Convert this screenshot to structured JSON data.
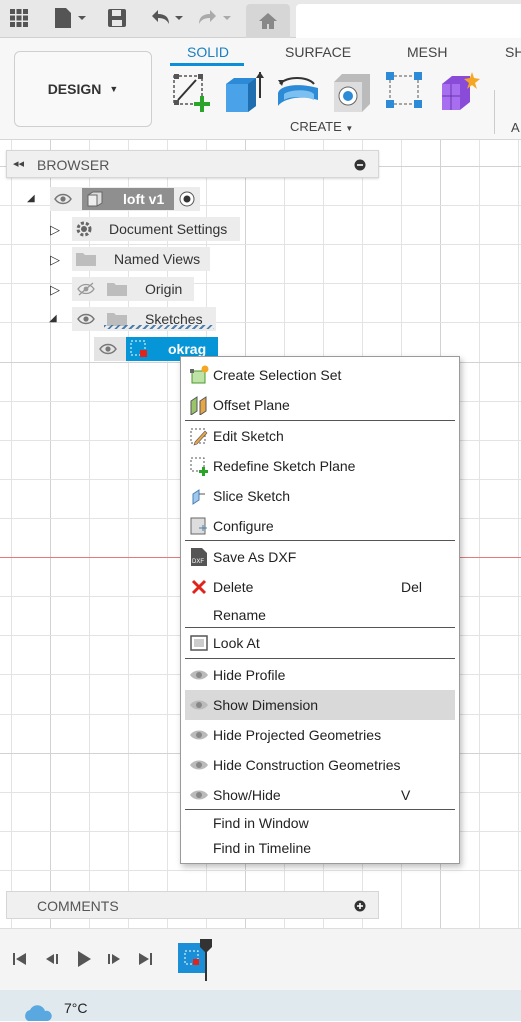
{
  "toolbar": {
    "workspace_label": "DESIGN",
    "tabs": [
      {
        "label": "SOLID"
      },
      {
        "label": "SURFACE"
      },
      {
        "label": "MESH"
      },
      {
        "label": "SH"
      }
    ],
    "create_label": "CREATE",
    "right_partial_label": "A",
    "tools": [
      "create-sketch-icon",
      "extrude-icon",
      "revolve-icon",
      "hole-icon",
      "pattern-icon",
      "create-form-icon"
    ]
  },
  "browser": {
    "title": "BROWSER",
    "root": {
      "label": "loft v1"
    },
    "items": [
      {
        "label": "Document Settings"
      },
      {
        "label": "Named Views"
      },
      {
        "label": "Origin"
      },
      {
        "label": "Sketches"
      }
    ],
    "selected_sketch": "okrag"
  },
  "context_menu": {
    "items": [
      {
        "label": "Create Selection Set",
        "icon": "selection-set-icon"
      },
      {
        "label": "Offset Plane",
        "icon": "offset-plane-icon"
      },
      {
        "label": "Edit Sketch",
        "icon": "edit-sketch-icon"
      },
      {
        "label": "Redefine Sketch Plane",
        "icon": "redefine-plane-icon"
      },
      {
        "label": "Slice Sketch",
        "icon": "slice-icon"
      },
      {
        "label": "Configure",
        "icon": "configure-icon"
      },
      {
        "label": "Save As DXF",
        "icon": "dxf-icon"
      },
      {
        "label": "Delete",
        "icon": "delete-icon",
        "shortcut": "Del"
      },
      {
        "label": "Rename"
      },
      {
        "label": "Look At",
        "icon": "look-at-icon"
      },
      {
        "label": "Hide Profile",
        "icon": "eye-icon"
      },
      {
        "label": "Show Dimension",
        "icon": "eye-icon"
      },
      {
        "label": "Hide Projected Geometries",
        "icon": "eye-icon"
      },
      {
        "label": "Hide Construction Geometries",
        "icon": "eye-icon"
      },
      {
        "label": "Show/Hide",
        "icon": "eye-icon",
        "shortcut": "V"
      },
      {
        "label": "Find in Window"
      },
      {
        "label": "Find in Timeline"
      }
    ],
    "highlighted": "Show Dimension"
  },
  "comments": {
    "title": "COMMENTS"
  },
  "taskbar": {
    "temperature": "7°C"
  },
  "colors": {
    "accent": "#0a8fd8",
    "selected_node": "#0696d7",
    "delete_red": "#e0241b"
  }
}
